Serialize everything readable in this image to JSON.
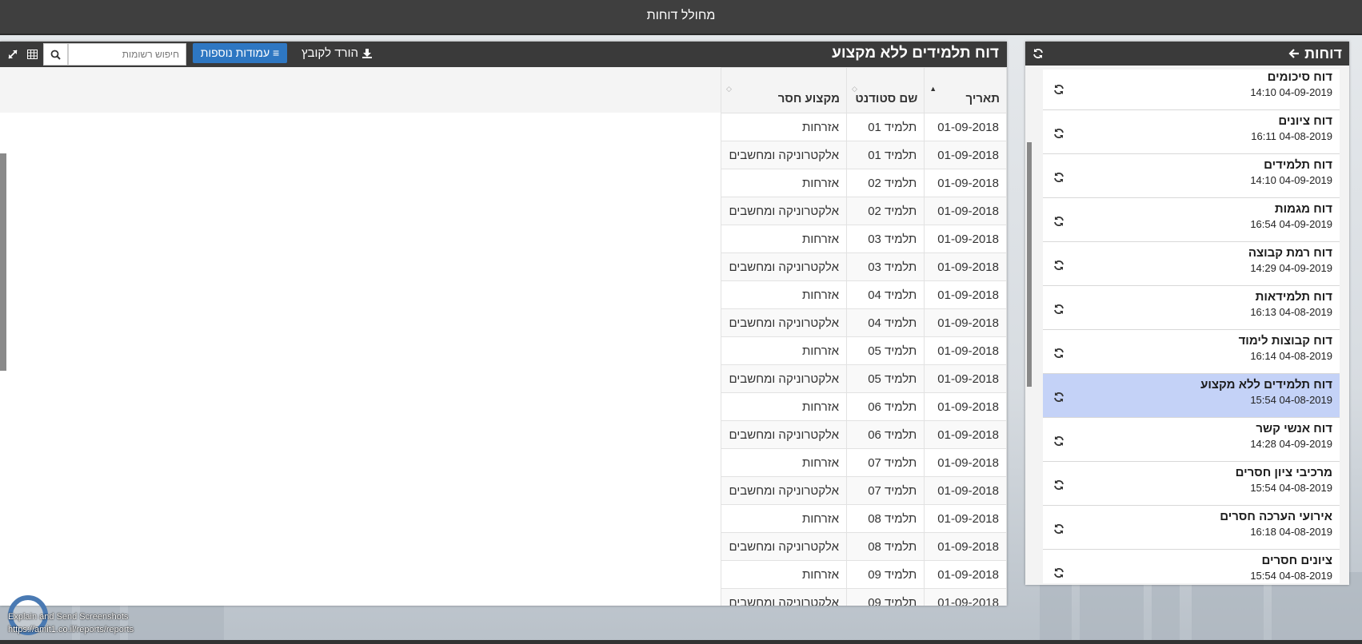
{
  "app": {
    "title": "מחולל דוחות"
  },
  "sidebar": {
    "title": "דוחות",
    "items": [
      {
        "name": "דוח סיכומים",
        "date": "04-09-2019 14:10",
        "active": false
      },
      {
        "name": "דוח ציונים",
        "date": "04-08-2019 16:11",
        "active": false
      },
      {
        "name": "דוח תלמידים",
        "date": "04-09-2019 14:10",
        "active": false
      },
      {
        "name": "דוח מגמות",
        "date": "04-09-2019 16:54",
        "active": false
      },
      {
        "name": "דוח רמת קבוצה",
        "date": "04-09-2019 14:29",
        "active": false
      },
      {
        "name": "דוח תלמידאות",
        "date": "04-08-2019 16:13",
        "active": false
      },
      {
        "name": "דוח קבוצות לימוד",
        "date": "04-08-2019 16:14",
        "active": false
      },
      {
        "name": "דוח תלמידים ללא מקצוע",
        "date": "04-08-2019 15:54",
        "active": true
      },
      {
        "name": "דוח אנשי קשר",
        "date": "04-09-2019 14:28",
        "active": false
      },
      {
        "name": "מרכיבי ציון חסרים",
        "date": "04-08-2019 15:54",
        "active": false
      },
      {
        "name": "אירועי הערכה חסרים",
        "date": "04-08-2019 16:18",
        "active": false
      },
      {
        "name": "ציונים חסרים",
        "date": "04-08-2019 15:54",
        "active": false
      }
    ]
  },
  "report": {
    "title": "דוח תלמידים ללא מקצוע",
    "download_label": "הורד לקובץ",
    "columns_label": "עמודות נוספות",
    "search_placeholder": "חיפוש רשומות",
    "headers": [
      "תאריך",
      "שם סטודנט",
      "מקצוע חסר"
    ],
    "rows": [
      [
        "01-09-2018",
        "תלמיד 01",
        "אזרחות"
      ],
      [
        "01-09-2018",
        "תלמיד 01",
        "אלקטרוניקה ומחשבים"
      ],
      [
        "01-09-2018",
        "תלמיד 02",
        "אזרחות"
      ],
      [
        "01-09-2018",
        "תלמיד 02",
        "אלקטרוניקה ומחשבים"
      ],
      [
        "01-09-2018",
        "תלמיד 03",
        "אזרחות"
      ],
      [
        "01-09-2018",
        "תלמיד 03",
        "אלקטרוניקה ומחשבים"
      ],
      [
        "01-09-2018",
        "תלמיד 04",
        "אזרחות"
      ],
      [
        "01-09-2018",
        "תלמיד 04",
        "אלקטרוניקה ומחשבים"
      ],
      [
        "01-09-2018",
        "תלמיד 05",
        "אזרחות"
      ],
      [
        "01-09-2018",
        "תלמיד 05",
        "אלקטרוניקה ומחשבים"
      ],
      [
        "01-09-2018",
        "תלמיד 06",
        "אזרחות"
      ],
      [
        "01-09-2018",
        "תלמיד 06",
        "אלקטרוניקה ומחשבים"
      ],
      [
        "01-09-2018",
        "תלמיד 07",
        "אזרחות"
      ],
      [
        "01-09-2018",
        "תלמיד 07",
        "אלקטרוניקה ומחשבים"
      ],
      [
        "01-09-2018",
        "תלמיד 08",
        "אזרחות"
      ],
      [
        "01-09-2018",
        "תלמיד 08",
        "אלקטרוניקה ומחשבים"
      ],
      [
        "01-09-2018",
        "תלמיד 09",
        "אזרחות"
      ],
      [
        "01-09-2018",
        "תלמיד 09",
        "אלקטרוניקה ומחשבים"
      ]
    ]
  },
  "widget": {
    "line1": "Explain and Send Screenshots",
    "line2": "https://amit1.co.il/reports/reports"
  },
  "colors": {
    "accent": "#2e77c2",
    "active_row": "#c4d2f7",
    "header_bg": "#3a3a3a"
  }
}
